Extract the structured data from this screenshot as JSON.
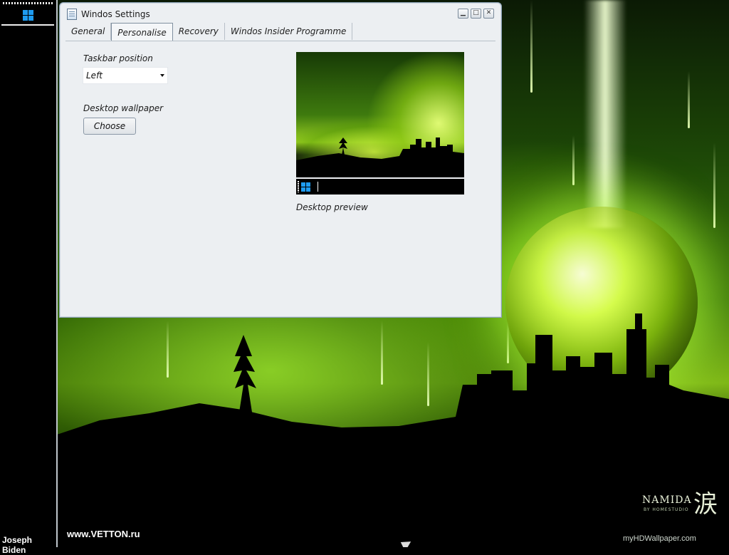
{
  "colors": {
    "accent": "#1e9bf0",
    "window_bg": "#eceff2",
    "taskbar_bg": "#000000"
  },
  "taskbar": {
    "start_icon": "windows-logo-icon",
    "user_name": "Joseph Biden"
  },
  "window": {
    "title": "Windos Settings",
    "icon": "settings-app-icon",
    "controls": {
      "minimize": "minimize-icon",
      "maximize": "maximize-icon",
      "close": "close-icon"
    },
    "tabs": [
      {
        "label": "General",
        "active": false
      },
      {
        "label": "Personalise",
        "active": true
      },
      {
        "label": "Recovery",
        "active": false
      },
      {
        "label": "Windos Insider Programme",
        "active": false
      }
    ],
    "personalise": {
      "taskbar_position_label": "Taskbar position",
      "taskbar_position_value": "Left",
      "desktop_wallpaper_label": "Desktop wallpaper",
      "choose_button": "Choose",
      "preview_caption": "Desktop preview"
    }
  },
  "wallpaper": {
    "watermark_left": "www.VETTON.ru",
    "watermark_right": "myHDWallpaper.com",
    "logo_text": "NAMIDA",
    "logo_sub": "BY HOMESTUDIO",
    "logo_kanji": "涙"
  }
}
